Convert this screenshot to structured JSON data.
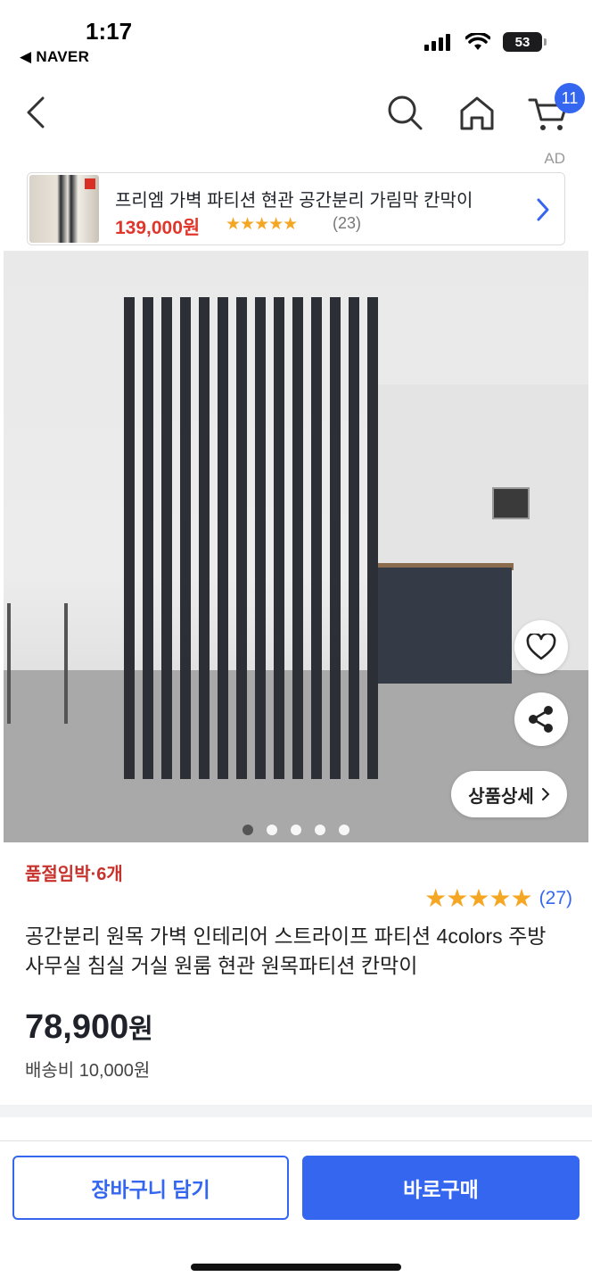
{
  "status_bar": {
    "time": "1:17",
    "back_app": "◀ NAVER",
    "battery": "53"
  },
  "nav": {
    "cart_count": "11",
    "ad_label": "AD"
  },
  "ad_banner": {
    "title": "프리엠 가벽 파티션 현관 공간분리 가림막 칸막이",
    "price": "139,000원",
    "stars": "★★★★★",
    "review_count": "(23)"
  },
  "image": {
    "detail_button": "상품상세",
    "slide_count": 5,
    "active_slide": 1
  },
  "product": {
    "stock_notice": "품절임박·6개",
    "stars": "★★★★★",
    "review_count": "(27)",
    "title": "공간분리 원목 가벽 인테리어 스트라이프 파티션 4colors 주방 사무실 침실 거실 원룸 현관 원목파티션 칸막이",
    "price": "78,900",
    "price_unit": "원",
    "shipping": "배송비 10,000원"
  },
  "actions": {
    "cart_button": "장바구니 담기",
    "buy_button": "바로구매"
  },
  "colors": {
    "accent": "#3566f0",
    "sale_red": "#e0362b",
    "star": "#f5a623"
  },
  "icons": [
    "signal-icon",
    "wifi-icon",
    "battery-icon",
    "back-arrow-icon",
    "search-icon",
    "home-icon",
    "cart-icon",
    "chevron-right-icon",
    "heart-icon",
    "share-icon"
  ]
}
